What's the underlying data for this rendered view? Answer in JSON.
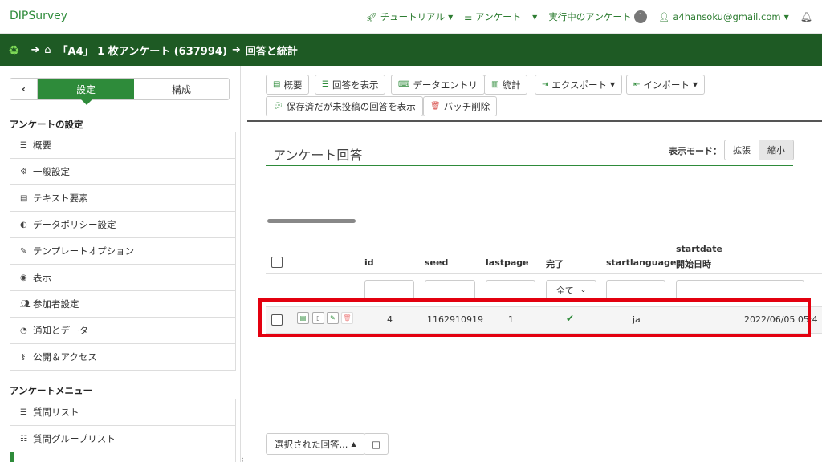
{
  "brand": "DIPSurvey",
  "topnav": {
    "tutorial": "チュートリアル",
    "surveys": "アンケート",
    "active_surveys": "実行中のアンケート",
    "active_count": "1",
    "user": "a4hansoku@gmail.com"
  },
  "breadcrumb": {
    "survey": "「A4」 1 枚アンケート (637994)",
    "page": "回答と統計"
  },
  "sidebar": {
    "tab_settings": "設定",
    "tab_structure": "構成",
    "settings_heading": "アンケートの設定",
    "settings_items": [
      {
        "label": "概要",
        "icon": "list-icon"
      },
      {
        "label": "一般設定",
        "icon": "gears-icon"
      },
      {
        "label": "テキスト要素",
        "icon": "file-text-icon"
      },
      {
        "label": "データポリシー設定",
        "icon": "shield-icon"
      },
      {
        "label": "テンプレートオプション",
        "icon": "paintbrush-icon"
      },
      {
        "label": "表示",
        "icon": "eye-icon"
      },
      {
        "label": "参加者設定",
        "icon": "users-icon"
      },
      {
        "label": "通知とデータ",
        "icon": "rss-icon"
      },
      {
        "label": "公開＆アクセス",
        "icon": "key-icon"
      }
    ],
    "menu_heading": "アンケートメニュー",
    "menu_items": [
      {
        "label": "質問リスト",
        "icon": "list-icon"
      },
      {
        "label": "質問グループリスト",
        "icon": "th-list-icon"
      }
    ]
  },
  "toolbar": {
    "summary": "概要",
    "show_responses": "回答を表示",
    "data_entry": "データエントリ",
    "statistics": "統計",
    "export": "エクスポート",
    "import": "インポート",
    "saved_unsubmitted": "保存済だが未投稿の回答を表示",
    "batch_delete": "バッチ削除"
  },
  "responses": {
    "title": "アンケート回答",
    "display_mode_label": "表示モード：",
    "mode_expand": "拡張",
    "mode_compact": "縮小",
    "columns": [
      "id",
      "seed",
      "lastpage",
      "完了",
      "startlanguage",
      "startdate",
      "開始日時"
    ],
    "completed_filter": "全て",
    "row": {
      "id": "4",
      "seed": "1162910919",
      "lastpage": "1",
      "startlanguage": "ja",
      "startdate": "2022/06/05 05:4"
    },
    "selected_responses_button": "選択された回答..."
  },
  "colors": {
    "brand_green": "#2e8b3a",
    "breadcrumb_bg": "#1e5a24",
    "highlight_red": "#e3000f"
  }
}
